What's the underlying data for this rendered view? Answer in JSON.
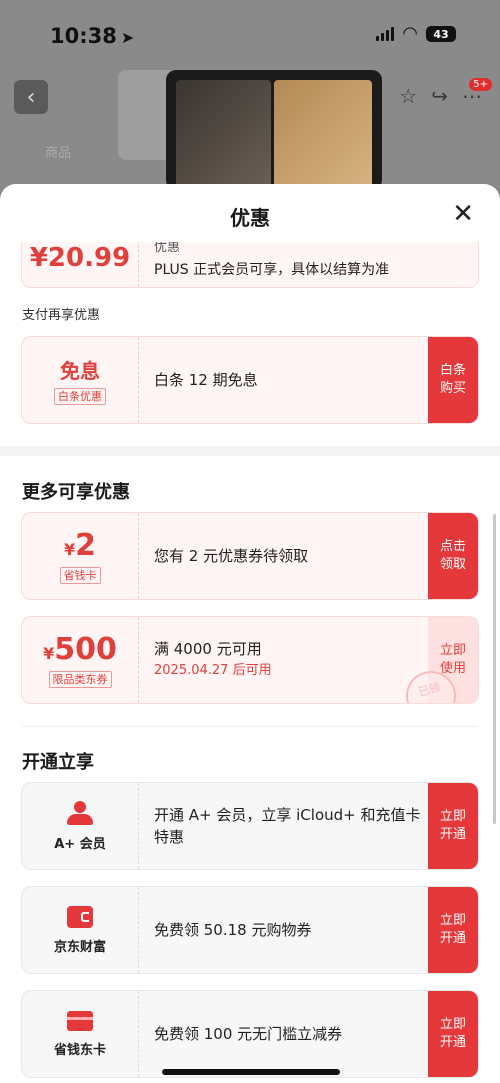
{
  "status_bar": {
    "time": "10:38",
    "battery": "43"
  },
  "background": {
    "cart_count": "5+",
    "faded_text": "商品"
  },
  "sheet": {
    "title": "优惠",
    "top_card": {
      "amount": "¥20.99",
      "partial_line": "优惠",
      "note": "PLUS 正式会员可享，具体以结算为准"
    },
    "pay_section_label": "支付再享优惠",
    "baitiao_card": {
      "title": "免息",
      "tag": "白条优惠",
      "desc": "白条 12 期免息",
      "button_line1": "白条",
      "button_line2": "购买"
    },
    "more_title": "更多可享优惠",
    "coupon_cards": [
      {
        "yen": "¥",
        "amount": "2",
        "tag": "省钱卡",
        "desc": "您有 2 元优惠券待领取",
        "sub": "",
        "button_line1": "点击",
        "button_line2": "领取"
      },
      {
        "yen": "¥",
        "amount": "500",
        "tag": "限品类东券",
        "desc": "满 4000 元可用",
        "sub": "2025.04.27 后可用",
        "button_line1": "立即",
        "button_line2": "使用",
        "stamp": "已领"
      }
    ],
    "open_title": "开通立享",
    "open_cards": [
      {
        "icon": "person-icon",
        "label": "A+ 会员",
        "desc": "开通 A+ 会员，立享 iCloud+ 和充值卡特惠",
        "button_line1": "立即",
        "button_line2": "开通"
      },
      {
        "icon": "wallet-icon",
        "label": "京东财富",
        "desc": "免费领 50.18 元购物券",
        "button_line1": "立即",
        "button_line2": "开通"
      },
      {
        "icon": "card-icon",
        "label": "省钱东卡",
        "desc": "免费领 100 元无门槛立减券",
        "button_line1": "立即",
        "button_line2": "开通"
      }
    ]
  },
  "colors": {
    "accent": "#e5383b",
    "card_bg": "#fff5f5"
  }
}
